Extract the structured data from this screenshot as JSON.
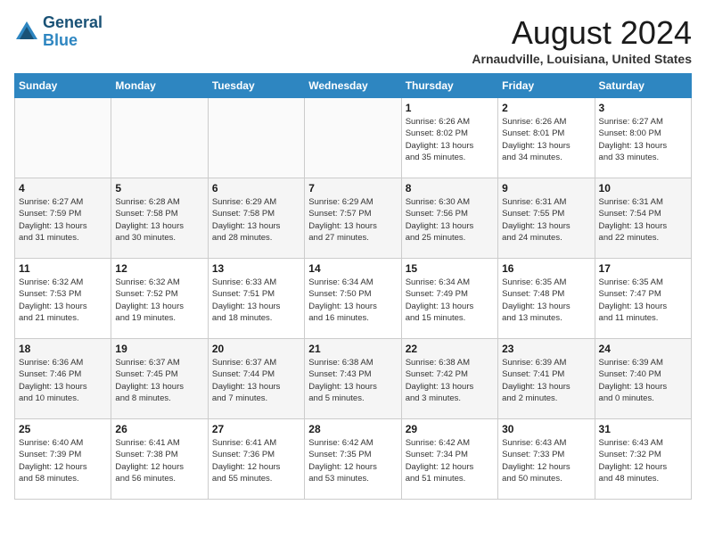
{
  "header": {
    "logo_general": "General",
    "logo_blue": "Blue",
    "month_title": "August 2024",
    "location": "Arnaudville, Louisiana, United States"
  },
  "days_of_week": [
    "Sunday",
    "Monday",
    "Tuesday",
    "Wednesday",
    "Thursday",
    "Friday",
    "Saturday"
  ],
  "weeks": [
    [
      {
        "day": "",
        "content": ""
      },
      {
        "day": "",
        "content": ""
      },
      {
        "day": "",
        "content": ""
      },
      {
        "day": "",
        "content": ""
      },
      {
        "day": "1",
        "content": "Sunrise: 6:26 AM\nSunset: 8:02 PM\nDaylight: 13 hours\nand 35 minutes."
      },
      {
        "day": "2",
        "content": "Sunrise: 6:26 AM\nSunset: 8:01 PM\nDaylight: 13 hours\nand 34 minutes."
      },
      {
        "day": "3",
        "content": "Sunrise: 6:27 AM\nSunset: 8:00 PM\nDaylight: 13 hours\nand 33 minutes."
      }
    ],
    [
      {
        "day": "4",
        "content": "Sunrise: 6:27 AM\nSunset: 7:59 PM\nDaylight: 13 hours\nand 31 minutes."
      },
      {
        "day": "5",
        "content": "Sunrise: 6:28 AM\nSunset: 7:58 PM\nDaylight: 13 hours\nand 30 minutes."
      },
      {
        "day": "6",
        "content": "Sunrise: 6:29 AM\nSunset: 7:58 PM\nDaylight: 13 hours\nand 28 minutes."
      },
      {
        "day": "7",
        "content": "Sunrise: 6:29 AM\nSunset: 7:57 PM\nDaylight: 13 hours\nand 27 minutes."
      },
      {
        "day": "8",
        "content": "Sunrise: 6:30 AM\nSunset: 7:56 PM\nDaylight: 13 hours\nand 25 minutes."
      },
      {
        "day": "9",
        "content": "Sunrise: 6:31 AM\nSunset: 7:55 PM\nDaylight: 13 hours\nand 24 minutes."
      },
      {
        "day": "10",
        "content": "Sunrise: 6:31 AM\nSunset: 7:54 PM\nDaylight: 13 hours\nand 22 minutes."
      }
    ],
    [
      {
        "day": "11",
        "content": "Sunrise: 6:32 AM\nSunset: 7:53 PM\nDaylight: 13 hours\nand 21 minutes."
      },
      {
        "day": "12",
        "content": "Sunrise: 6:32 AM\nSunset: 7:52 PM\nDaylight: 13 hours\nand 19 minutes."
      },
      {
        "day": "13",
        "content": "Sunrise: 6:33 AM\nSunset: 7:51 PM\nDaylight: 13 hours\nand 18 minutes."
      },
      {
        "day": "14",
        "content": "Sunrise: 6:34 AM\nSunset: 7:50 PM\nDaylight: 13 hours\nand 16 minutes."
      },
      {
        "day": "15",
        "content": "Sunrise: 6:34 AM\nSunset: 7:49 PM\nDaylight: 13 hours\nand 15 minutes."
      },
      {
        "day": "16",
        "content": "Sunrise: 6:35 AM\nSunset: 7:48 PM\nDaylight: 13 hours\nand 13 minutes."
      },
      {
        "day": "17",
        "content": "Sunrise: 6:35 AM\nSunset: 7:47 PM\nDaylight: 13 hours\nand 11 minutes."
      }
    ],
    [
      {
        "day": "18",
        "content": "Sunrise: 6:36 AM\nSunset: 7:46 PM\nDaylight: 13 hours\nand 10 minutes."
      },
      {
        "day": "19",
        "content": "Sunrise: 6:37 AM\nSunset: 7:45 PM\nDaylight: 13 hours\nand 8 minutes."
      },
      {
        "day": "20",
        "content": "Sunrise: 6:37 AM\nSunset: 7:44 PM\nDaylight: 13 hours\nand 7 minutes."
      },
      {
        "day": "21",
        "content": "Sunrise: 6:38 AM\nSunset: 7:43 PM\nDaylight: 13 hours\nand 5 minutes."
      },
      {
        "day": "22",
        "content": "Sunrise: 6:38 AM\nSunset: 7:42 PM\nDaylight: 13 hours\nand 3 minutes."
      },
      {
        "day": "23",
        "content": "Sunrise: 6:39 AM\nSunset: 7:41 PM\nDaylight: 13 hours\nand 2 minutes."
      },
      {
        "day": "24",
        "content": "Sunrise: 6:39 AM\nSunset: 7:40 PM\nDaylight: 13 hours\nand 0 minutes."
      }
    ],
    [
      {
        "day": "25",
        "content": "Sunrise: 6:40 AM\nSunset: 7:39 PM\nDaylight: 12 hours\nand 58 minutes."
      },
      {
        "day": "26",
        "content": "Sunrise: 6:41 AM\nSunset: 7:38 PM\nDaylight: 12 hours\nand 56 minutes."
      },
      {
        "day": "27",
        "content": "Sunrise: 6:41 AM\nSunset: 7:36 PM\nDaylight: 12 hours\nand 55 minutes."
      },
      {
        "day": "28",
        "content": "Sunrise: 6:42 AM\nSunset: 7:35 PM\nDaylight: 12 hours\nand 53 minutes."
      },
      {
        "day": "29",
        "content": "Sunrise: 6:42 AM\nSunset: 7:34 PM\nDaylight: 12 hours\nand 51 minutes."
      },
      {
        "day": "30",
        "content": "Sunrise: 6:43 AM\nSunset: 7:33 PM\nDaylight: 12 hours\nand 50 minutes."
      },
      {
        "day": "31",
        "content": "Sunrise: 6:43 AM\nSunset: 7:32 PM\nDaylight: 12 hours\nand 48 minutes."
      }
    ]
  ]
}
